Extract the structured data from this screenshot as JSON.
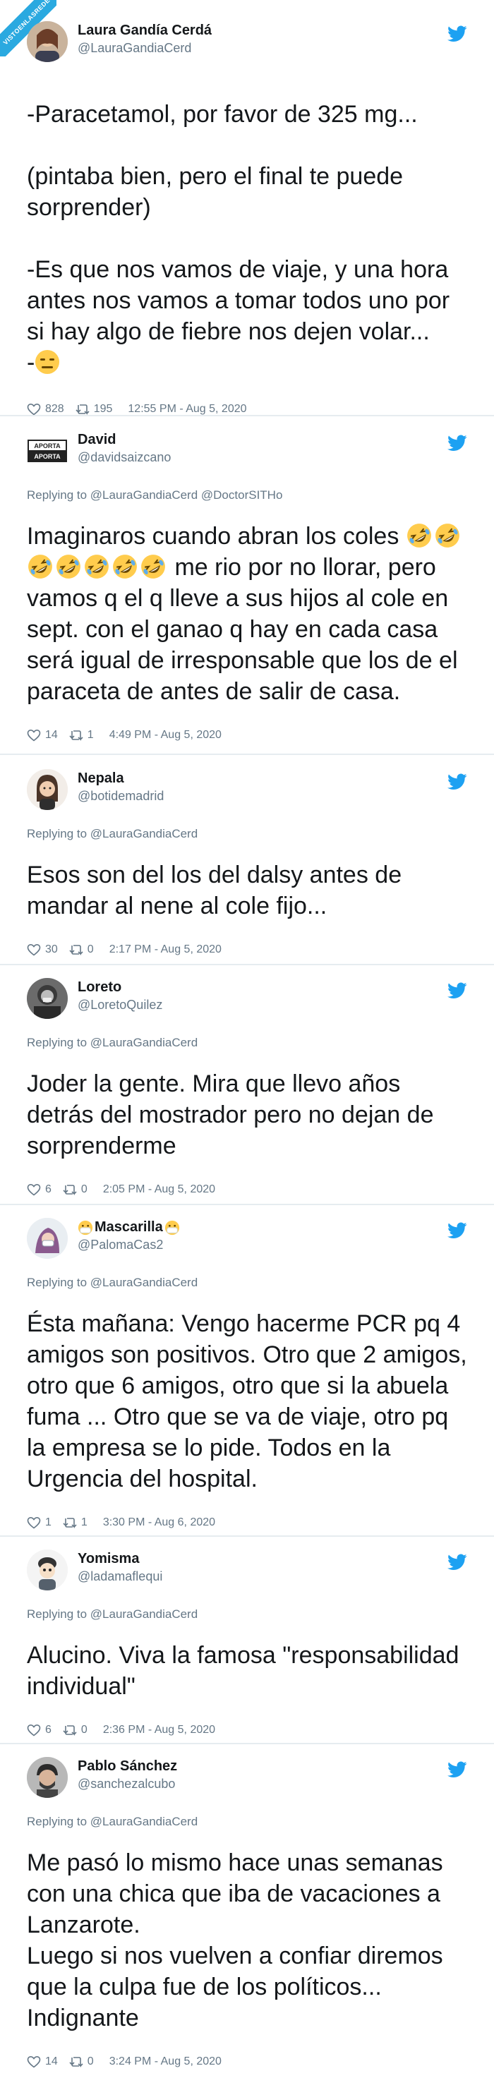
{
  "watermark": {
    "text": "VISTOENLASREDES"
  },
  "colors": {
    "twitter_blue": "#1da1f2",
    "meta_gray": "#657786",
    "divider": "#e6ecf0"
  },
  "tweets": [
    {
      "name": "Laura Gandía Cerdá",
      "handle": "@LauraGandiaCerd",
      "replying": "",
      "text": "-Paracetamol, por favor de 325 mg...\n\n(pintaba bien, pero el final te puede sorprender)\n\n-Es que nos vamos de viaje, y una hora antes nos vamos a tomar todos uno por si hay algo de fiebre nos dejen volar...\n-",
      "likes": "828",
      "retweets": "195",
      "time": "12:55 PM - Aug 5, 2020"
    },
    {
      "name": "David",
      "handle": "@davidsaizcano",
      "replying": "Replying to @LauraGandiaCerd @DoctorSITHo",
      "text_before": "Imaginaros cuando abran los coles ",
      "text_after": " me rio por no llorar, pero vamos q el q lleve a sus hijos al cole en sept. con el ganao q hay en cada casa será igual de irresponsable que los de el paraceta de antes de salir de casa.",
      "likes": "14",
      "retweets": "1",
      "time": "4:49 PM - Aug 5, 2020"
    },
    {
      "name": "Nepala",
      "handle": "@botidemadrid",
      "replying": "Replying to @LauraGandiaCerd",
      "text": "Esos son del los del dalsy antes de mandar al nene al cole fijo...",
      "likes": "30",
      "retweets": "0",
      "time": "2:17 PM - Aug 5, 2020"
    },
    {
      "name": "Loreto",
      "handle": "@LoretoQuilez",
      "replying": "Replying to @LauraGandiaCerd",
      "text": "Joder la gente. Mira que llevo años detrás del mostrador pero no dejan de sorprenderme",
      "likes": "6",
      "retweets": "0",
      "time": "2:05 PM - Aug 5, 2020"
    },
    {
      "name": "Mascarilla",
      "handle": "@PalomaCas2",
      "replying": "Replying to @LauraGandiaCerd",
      "text": "Ésta mañana: Vengo hacerme PCR pq 4 amigos son positivos. Otro que 2 amigos, otro que 6 amigos, otro que si la abuela fuma ... Otro que se va de viaje, otro pq la empresa se lo pide. Todos en la Urgencia del hospital.",
      "likes": "1",
      "retweets": "1",
      "time": "3:30 PM - Aug 6, 2020"
    },
    {
      "name": "Yomisma",
      "handle": "@ladamaflequi",
      "replying": "Replying to @LauraGandiaCerd",
      "text": "Alucino. Viva la famosa \"responsabilidad individual\"",
      "likes": "6",
      "retweets": "0",
      "time": "2:36 PM - Aug 5, 2020"
    },
    {
      "name": "Pablo Sánchez",
      "handle": "@sanchezalcubo",
      "replying": "Replying to @LauraGandiaCerd",
      "text": "Me pasó lo mismo hace unas semanas con una chica que iba de vacaciones a Lanzarote.\nLuego si nos vuelven a confiar diremos que la culpa fue de los políticos...\nIndignante",
      "likes": "14",
      "retweets": "0",
      "time": "3:24 PM - Aug 5, 2020"
    }
  ]
}
